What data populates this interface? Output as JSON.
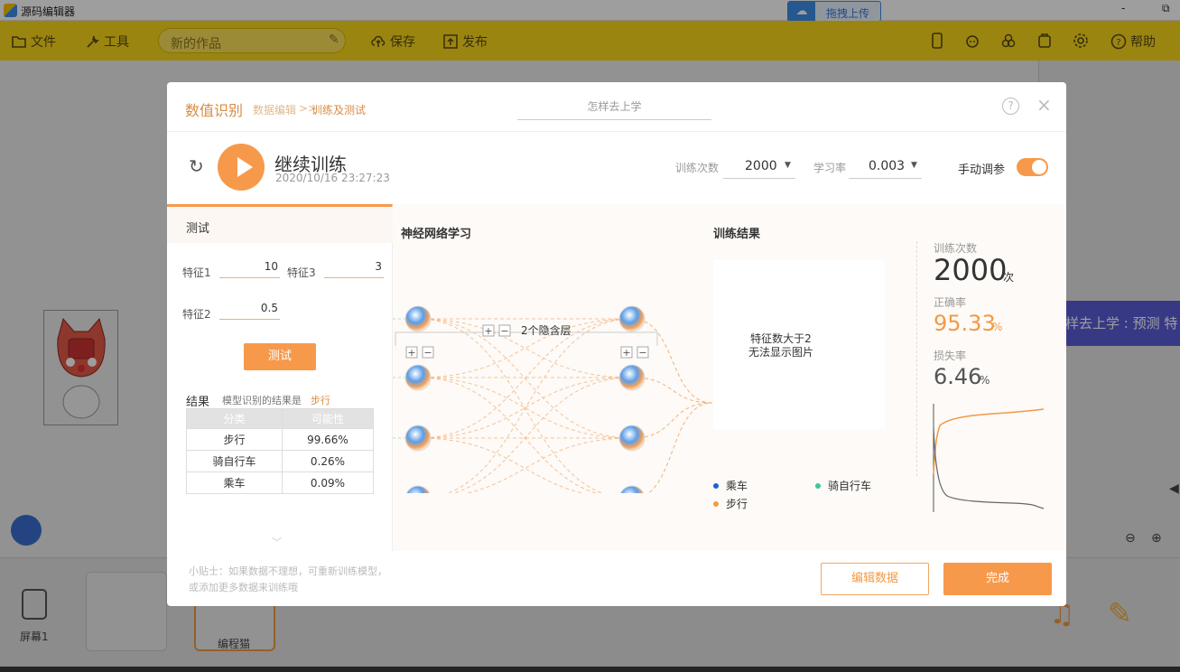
{
  "window": {
    "title": "源码编辑器",
    "minimize": "-",
    "maximize": "⧉",
    "upload_label": "拖拽上传"
  },
  "toolbar": {
    "file": "文件",
    "tools": "工具",
    "project_name": "新的作品",
    "save": "保存",
    "publish": "发布",
    "help": "帮助"
  },
  "stage": {
    "marquee_text": "样去上学 : 预测 特",
    "screen_label": "屏幕1",
    "sprite_label": "编程猫"
  },
  "modal": {
    "title": "数值识别",
    "breadcrumb": {
      "data": "数据编辑",
      "separator": ">>",
      "current": "训练及测试"
    },
    "model_name": "怎样去上学",
    "help": "?",
    "close": "×",
    "training": {
      "title": "继续训练",
      "timestamp": "2020/10/16 23:27:23",
      "epochs_label": "训练次数",
      "epochs_value": "2000",
      "lr_label": "学习率",
      "lr_value": "0.003",
      "manual_label": "手动调参",
      "manual_enabled": true
    },
    "test": {
      "tab": "测试",
      "features": [
        {
          "label": "特征1",
          "value": "10"
        },
        {
          "label": "特征3",
          "value": "3"
        },
        {
          "label": "特征2",
          "value": "0.5"
        }
      ],
      "button": "测试",
      "result_label": "结果",
      "result_desc": "模型识别的结果是",
      "result_value": "步行",
      "table_headers": [
        "分类",
        "可能性"
      ],
      "rows": [
        {
          "class": "步行",
          "prob": "99.66%"
        },
        {
          "class": "骑自行车",
          "prob": "0.26%"
        },
        {
          "class": "乘车",
          "prob": "0.09%"
        }
      ]
    },
    "network": {
      "title": "神经网络学习",
      "hidden_label": "2个隐含层",
      "plus": "+",
      "minus": "−",
      "layers": [
        4,
        4,
        4
      ]
    },
    "results": {
      "title": "训练结果",
      "image_line1": "特征数大于2",
      "image_line2": "无法显示图片",
      "legend": [
        {
          "name": "乘车",
          "color": "#1f5fd6"
        },
        {
          "name": "骑自行车",
          "color": "#3cc7a0"
        },
        {
          "name": "步行",
          "color": "#f29a45"
        }
      ],
      "epochs_label": "训练次数",
      "epochs_value": "2000",
      "epochs_unit": "次",
      "accuracy_label": "正确率",
      "accuracy_value": "95.33",
      "accuracy_unit": "%",
      "loss_label": "损失率",
      "loss_value": "6.46",
      "loss_unit": "%"
    },
    "footer": {
      "tip_line1": "小贴士：如果数据不理想，可重新训练模型，",
      "tip_line2": "或添加更多数据来训练哦",
      "edit_data": "编辑数据",
      "done": "完成"
    }
  },
  "colors": {
    "accent": "#f7994b",
    "toolbar": "#f9d71c",
    "blue": "#3a8ee6"
  }
}
